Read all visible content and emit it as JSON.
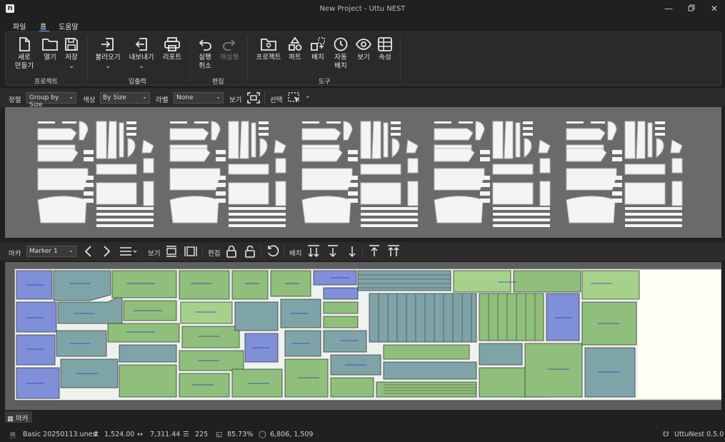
{
  "window": {
    "title": "New Project - Uttu NEST",
    "logo": "n"
  },
  "menu": {
    "items": [
      "파일",
      "홈",
      "도움말"
    ]
  },
  "ribbon": {
    "project": {
      "new_label_1": "새로",
      "new_label_2": "만들기",
      "open_label": "열기",
      "save_label": "저장",
      "group_label": "프로젝트"
    },
    "io": {
      "import_label": "불러오기",
      "export_label": "내보내기",
      "report_label": "리포트",
      "group_label": "입출력"
    },
    "edit": {
      "undo_label_1": "실행",
      "undo_label_2": "취소",
      "redo_label": "재실행",
      "group_label": "편집"
    },
    "tools": {
      "project_label": "프로젝트",
      "part_label": "파트",
      "layout_label": "배치",
      "auto_label_1": "자동",
      "auto_label_2": "배치",
      "view_label": "보기",
      "props_label": "속성",
      "group_label": "도구"
    }
  },
  "toolbar1": {
    "sort_label": "정렬",
    "sort_value": "Group by Size",
    "color_label": "색상",
    "color_value": "By Size",
    "label_label": "라벨",
    "label_value": "None",
    "view_label": "보기",
    "select_label": "선택"
  },
  "toolbar2": {
    "marker_label": "마카",
    "marker_value": "Marker 1",
    "view_label": "보기",
    "edit_label": "편집",
    "layout_label": "배치"
  },
  "bottom_tab": {
    "label": "마카"
  },
  "status": {
    "file": "Basic 20250113.unest",
    "width": "1,524.00",
    "length": "7,311.44",
    "count": "225",
    "efficiency": "85.73%",
    "coords": "6,806, 1,509",
    "version": "UttuNest 0.5.0"
  },
  "colors": {
    "accent": "#4aa3ff",
    "piece_blue": "#7f8fd8",
    "piece_teal": "#7fa4a8",
    "piece_green": "#8fbf7a",
    "piece_lightgreen": "#a6d18a",
    "marker_bg": "#fffff4"
  }
}
